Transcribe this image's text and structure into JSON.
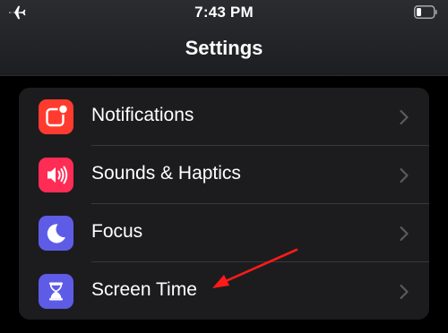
{
  "status_bar": {
    "time": "7:43 PM",
    "left_icon": "airplane-icon",
    "right_icon": "battery-icon"
  },
  "nav": {
    "title": "Settings"
  },
  "settings": {
    "items": [
      {
        "label": "Notifications",
        "icon": "notifications-icon",
        "icon_bg": "#ff3b30"
      },
      {
        "label": "Sounds & Haptics",
        "icon": "speaker-icon",
        "icon_bg": "#ff2d55"
      },
      {
        "label": "Focus",
        "icon": "moon-icon",
        "icon_bg": "#5e5ce6"
      },
      {
        "label": "Screen Time",
        "icon": "hourglass-icon",
        "icon_bg": "#5e5ce6"
      }
    ]
  },
  "annotation": {
    "arrow_color": "#ff1a1a",
    "points_to": "Screen Time"
  }
}
